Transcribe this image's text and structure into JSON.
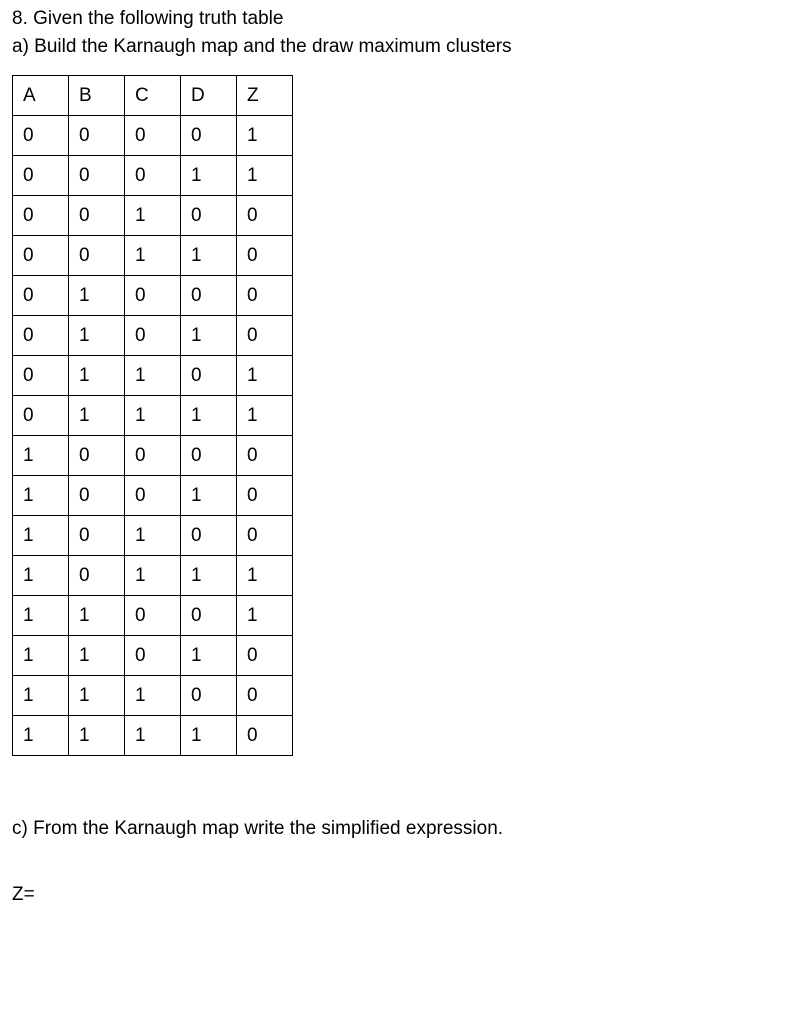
{
  "question": {
    "number_line": "8. Given the following truth table",
    "part_a": "a) Build the Karnaugh map and the draw maximum clusters",
    "part_c": "c) From the Karnaugh map write the simplified expression.",
    "answer_prefix": "Z="
  },
  "table": {
    "headers": [
      "A",
      "B",
      "C",
      "D",
      "Z"
    ],
    "rows": [
      [
        "0",
        "0",
        "0",
        "0",
        "1"
      ],
      [
        "0",
        "0",
        "0",
        "1",
        "1"
      ],
      [
        "0",
        "0",
        "1",
        "0",
        "0"
      ],
      [
        "0",
        "0",
        "1",
        "1",
        "0"
      ],
      [
        "0",
        "1",
        "0",
        "0",
        "0"
      ],
      [
        "0",
        "1",
        "0",
        "1",
        "0"
      ],
      [
        "0",
        "1",
        "1",
        "0",
        "1"
      ],
      [
        "0",
        "1",
        "1",
        "1",
        "1"
      ],
      [
        "1",
        "0",
        "0",
        "0",
        "0"
      ],
      [
        "1",
        "0",
        "0",
        "1",
        "0"
      ],
      [
        "1",
        "0",
        "1",
        "0",
        "0"
      ],
      [
        "1",
        "0",
        "1",
        "1",
        "1"
      ],
      [
        "1",
        "1",
        "0",
        "0",
        "1"
      ],
      [
        "1",
        "1",
        "0",
        "1",
        "0"
      ],
      [
        "1",
        "1",
        "1",
        "0",
        "0"
      ],
      [
        "1",
        "1",
        "1",
        "1",
        "0"
      ]
    ]
  }
}
